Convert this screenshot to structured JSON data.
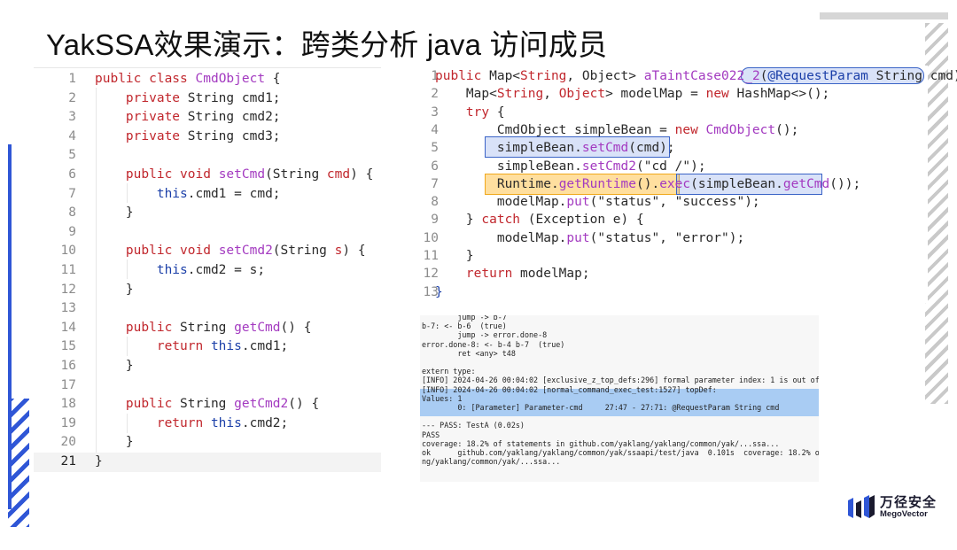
{
  "title": "YakSSA效果演示：跨类分析 java 访问成员",
  "logo": {
    "cn": "万径安全",
    "en": "MegoVector"
  },
  "left_editor": {
    "lines": [
      {
        "n": "1",
        "segs": [
          [
            "kw",
            "public class "
          ],
          [
            "fn",
            "CmdObject"
          ],
          [
            "cm",
            " {"
          ]
        ]
      },
      {
        "n": "2",
        "segs": [
          [
            "kw",
            "    private "
          ],
          [
            "cm",
            "String cmd1;"
          ]
        ]
      },
      {
        "n": "3",
        "segs": [
          [
            "kw",
            "    private "
          ],
          [
            "cm",
            "String cmd2;"
          ]
        ]
      },
      {
        "n": "4",
        "segs": [
          [
            "kw",
            "    private "
          ],
          [
            "cm",
            "String cmd3;"
          ]
        ]
      },
      {
        "n": "5",
        "segs": []
      },
      {
        "n": "6",
        "segs": [
          [
            "kw",
            "    public void "
          ],
          [
            "fn",
            "setCmd"
          ],
          [
            "cm",
            "(String "
          ],
          [
            "kw",
            "cmd"
          ],
          [
            "cm",
            ") {"
          ]
        ]
      },
      {
        "n": "7",
        "segs": [
          [
            "ty",
            "        this"
          ],
          [
            "cm",
            ".cmd1 = cmd;"
          ]
        ]
      },
      {
        "n": "8",
        "segs": [
          [
            "cm",
            "    }"
          ]
        ]
      },
      {
        "n": "9",
        "segs": []
      },
      {
        "n": "10",
        "segs": [
          [
            "kw",
            "    public void "
          ],
          [
            "fn",
            "setCmd2"
          ],
          [
            "cm",
            "(String "
          ],
          [
            "kw",
            "s"
          ],
          [
            "cm",
            ") {"
          ]
        ]
      },
      {
        "n": "11",
        "segs": [
          [
            "ty",
            "        this"
          ],
          [
            "cm",
            ".cmd2 = s;"
          ]
        ]
      },
      {
        "n": "12",
        "segs": [
          [
            "cm",
            "    }"
          ]
        ]
      },
      {
        "n": "13",
        "segs": []
      },
      {
        "n": "14",
        "segs": [
          [
            "kw",
            "    public "
          ],
          [
            "cm",
            "String "
          ],
          [
            "fn",
            "getCmd"
          ],
          [
            "cm",
            "() {"
          ]
        ]
      },
      {
        "n": "15",
        "segs": [
          [
            "kw",
            "        return "
          ],
          [
            "ty",
            "this"
          ],
          [
            "cm",
            ".cmd1;"
          ]
        ]
      },
      {
        "n": "16",
        "segs": [
          [
            "cm",
            "    }"
          ]
        ]
      },
      {
        "n": "17",
        "segs": []
      },
      {
        "n": "18",
        "segs": [
          [
            "kw",
            "    public "
          ],
          [
            "cm",
            "String "
          ],
          [
            "fn",
            "getCmd2"
          ],
          [
            "cm",
            "() {"
          ]
        ]
      },
      {
        "n": "19",
        "segs": [
          [
            "kw",
            "        return "
          ],
          [
            "ty",
            "this"
          ],
          [
            "cm",
            ".cmd2;"
          ]
        ]
      },
      {
        "n": "20",
        "segs": [
          [
            "cm",
            "    }"
          ]
        ]
      },
      {
        "n": "21",
        "segs": [
          [
            "cm",
            "}"
          ]
        ]
      }
    ]
  },
  "right_editor": {
    "lines": [
      {
        "n": "1",
        "segs": [
          [
            "kw",
            "public "
          ],
          [
            "cm",
            "Map<"
          ],
          [
            "kw",
            "String"
          ],
          [
            "cm",
            ", Object> "
          ],
          [
            "fn",
            "aTaintCase022_2"
          ],
          [
            "cm",
            "("
          ],
          [
            "ty",
            "@RequestParam "
          ],
          [
            "cm",
            "String cmd)"
          ]
        ]
      },
      {
        "n": "2",
        "segs": [
          [
            "cm",
            "    Map<"
          ],
          [
            "kw",
            "String"
          ],
          [
            "cm",
            ", "
          ],
          [
            "kw",
            "Object"
          ],
          [
            "cm",
            "> modelMap = "
          ],
          [
            "kw",
            "new "
          ],
          [
            "cm",
            "HashMap<>();"
          ]
        ]
      },
      {
        "n": "3",
        "segs": [
          [
            "kw",
            "    try "
          ],
          [
            "cm",
            "{"
          ]
        ]
      },
      {
        "n": "4",
        "segs": [
          [
            "cm",
            "        CmdObject simpleBean = "
          ],
          [
            "kw",
            "new "
          ],
          [
            "fn",
            "CmdObject"
          ],
          [
            "cm",
            "();"
          ]
        ]
      },
      {
        "n": "5",
        "segs": [
          [
            "cm",
            "        simpleBean."
          ],
          [
            "fn",
            "setCmd"
          ],
          [
            "cm",
            "(cmd);"
          ]
        ]
      },
      {
        "n": "6",
        "segs": [
          [
            "cm",
            "        simpleBean."
          ],
          [
            "fn",
            "setCmd2"
          ],
          [
            "cm",
            "(\"cd /\");"
          ]
        ]
      },
      {
        "n": "7",
        "segs": [
          [
            "cm",
            "        Runtime."
          ],
          [
            "fn",
            "getRuntime"
          ],
          [
            "cm",
            "()."
          ],
          [
            "fn",
            "exec"
          ],
          [
            "cm",
            "(simpleBean."
          ],
          [
            "fn",
            "getCmd"
          ],
          [
            "cm",
            "());"
          ]
        ]
      },
      {
        "n": "8",
        "segs": [
          [
            "cm",
            "        modelMap."
          ],
          [
            "fn",
            "put"
          ],
          [
            "cm",
            "(\"status\", \"success\");"
          ]
        ]
      },
      {
        "n": "9",
        "segs": [
          [
            "cm",
            "    } "
          ],
          [
            "kw",
            "catch "
          ],
          [
            "cm",
            "(Exception e) {"
          ]
        ]
      },
      {
        "n": "10",
        "segs": [
          [
            "cm",
            "        modelMap."
          ],
          [
            "fn",
            "put"
          ],
          [
            "cm",
            "(\"status\", \"error\");"
          ]
        ]
      },
      {
        "n": "11",
        "segs": [
          [
            "cm",
            "    }"
          ]
        ]
      },
      {
        "n": "12",
        "segs": [
          [
            "kw",
            "    return "
          ],
          [
            "cm",
            "modelMap;"
          ]
        ]
      },
      {
        "n": "13",
        "segs": [
          [
            "ty",
            "}"
          ]
        ]
      }
    ]
  },
  "console": {
    "lines": [
      "        jump -> b-7",
      "b-7: <- b-6  (true)",
      "        jump -> error.done-8",
      "error.done-8: <- b-4 b-7  (true)",
      "        ret <any> t48",
      "",
      "extern type:",
      "[INFO] 2024-04-26 00:04:02 [exclusive_z_top_defs:296] formal parameter index: 1 is out of",
      "[INFO] 2024-04-26 00:04:02 [normal_command_exec_test:1527] topDef:",
      "Values: 1",
      "        0: [Parameter] Parameter-cmd     27:47 - 27:71: @RequestParam String cmd",
      "",
      "--- PASS: TestA (0.02s)",
      "PASS",
      "coverage: 18.2% of statements in github.com/yaklang/yaklang/common/yak/...ssa...",
      "ok      github.com/yaklang/yaklang/common/yak/ssaapi/test/java  0.101s  coverage: 18.2% o",
      "ng/yaklang/common/yak/...ssa..."
    ]
  }
}
